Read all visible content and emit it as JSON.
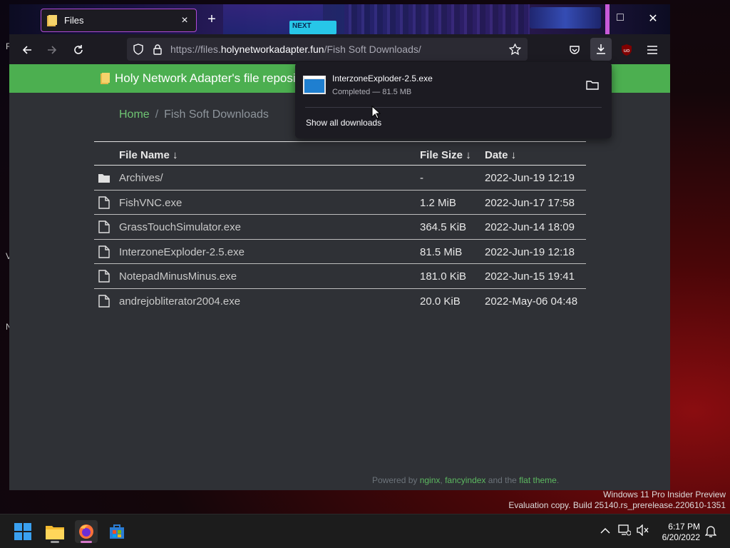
{
  "desktop": {
    "edge_letters": [
      "R",
      "V",
      "N"
    ],
    "watermark_line1": "Windows 11 Pro Insider Preview",
    "watermark_line2": "Evaluation copy. Build 25140.rs_prerelease.220610-1351"
  },
  "browser": {
    "tab": {
      "title": "Files",
      "close": "×"
    },
    "new_tab": "+",
    "theme_badge": "NEXT",
    "url": {
      "base": "https://files.",
      "host": "holynetworkadapter.fun",
      "path": "/Fish Soft Downloads/"
    },
    "window_controls": {
      "maximize": "□",
      "close": "✕"
    }
  },
  "page": {
    "banner_title": "Holy Network Adapter's file reposito",
    "breadcrumb": {
      "home": "Home",
      "separator": "/",
      "current": "Fish Soft Downloads"
    },
    "table": {
      "headers": {
        "name": "File Name ↓",
        "size": "File Size ↓",
        "date": "Date ↓"
      },
      "rows": [
        {
          "type": "folder",
          "name": "Archives/",
          "size": "-",
          "date": "2022-Jun-19 12:19"
        },
        {
          "type": "file",
          "name": "FishVNC.exe",
          "size": "1.2 MiB",
          "date": "2022-Jun-17 17:58"
        },
        {
          "type": "file",
          "name": "GrassTouchSimulator.exe",
          "size": "364.5 KiB",
          "date": "2022-Jun-14 18:09"
        },
        {
          "type": "file",
          "name": "InterzoneExploder-2.5.exe",
          "size": "81.5 MiB",
          "date": "2022-Jun-19 12:18"
        },
        {
          "type": "file",
          "name": "NotepadMinusMinus.exe",
          "size": "181.0 KiB",
          "date": "2022-Jun-15 19:41"
        },
        {
          "type": "file",
          "name": "andrejobliterator2004.exe",
          "size": "20.0 KiB",
          "date": "2022-May-06 04:48"
        }
      ]
    },
    "footer": {
      "prefix": "Powered by ",
      "nginx": "nginx",
      "comma": ", ",
      "fancyindex": "fancyindex",
      "mid": " and the ",
      "theme": "flat theme",
      "end": "."
    }
  },
  "downloads_panel": {
    "file_name": "InterzoneExploder-2.5.exe",
    "status": "Completed — 81.5 MB",
    "show_all": "Show all downloads"
  },
  "taskbar": {
    "time": "6:17 PM",
    "date": "6/20/2022"
  },
  "colors": {
    "banner": "#4caf50",
    "tab_border": "#b14ad6",
    "link": "#6ec472"
  }
}
